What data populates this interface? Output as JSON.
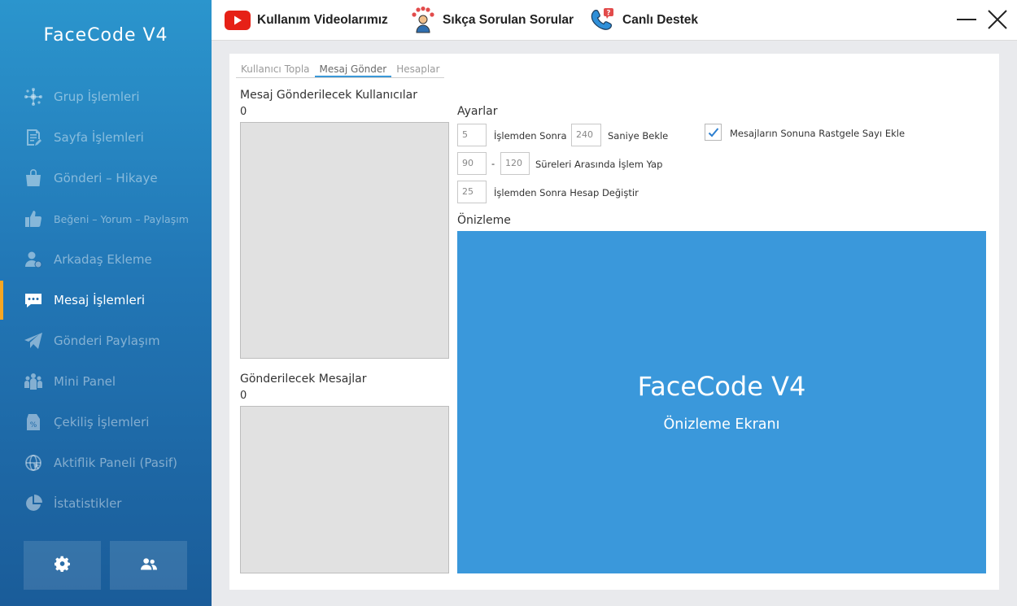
{
  "sidebar": {
    "app_title": "FaceCode V4",
    "items": [
      {
        "label": "Grup İşlemleri",
        "icon": "network-icon"
      },
      {
        "label": "Sayfa İşlemleri",
        "icon": "page-edit-icon"
      },
      {
        "label": "Gönderi – Hikaye",
        "icon": "shopping-bag-icon"
      },
      {
        "label": "Beğeni – Yorum – Paylaşım",
        "icon": "thumbs-up-icon"
      },
      {
        "label": "Arkadaş Ekleme",
        "icon": "user-add-icon"
      },
      {
        "label": "Mesaj İşlemleri",
        "icon": "chat-icon",
        "active": true
      },
      {
        "label": "Gönderi Paylaşım",
        "icon": "paper-plane-icon"
      },
      {
        "label": "Mini Panel",
        "icon": "group-icon"
      },
      {
        "label": "Çekiliş İşlemleri",
        "icon": "discount-tag-icon"
      },
      {
        "label": "Aktiflik Paneli (Pasif)",
        "icon": "globe-cursor-icon"
      },
      {
        "label": "İstatistikler",
        "icon": "pie-chart-icon"
      }
    ],
    "bottom_buttons": [
      "gear-icon",
      "users-icon"
    ]
  },
  "topbar": {
    "links": [
      {
        "label": "Kullanım Videolarımız",
        "icon": "youtube-icon"
      },
      {
        "label": "Sıkça Sorulan Sorular",
        "icon": "faq-person-icon"
      },
      {
        "label": "Canlı Destek",
        "icon": "phone-support-icon"
      }
    ]
  },
  "tabs": [
    "Kullanıcı Topla",
    "Mesaj Gönder",
    "Hesaplar"
  ],
  "users_section": {
    "title": "Mesaj Gönderilecek Kullanıcılar",
    "count": "0"
  },
  "messages_section": {
    "title": "Gönderilecek Mesajlar",
    "count": "0"
  },
  "settings": {
    "title": "Ayarlar",
    "after_ops_value": "5",
    "after_ops_label": "İşlemden Sonra",
    "wait_value": "240",
    "wait_label": "Saniye Bekle",
    "range_min": "90",
    "range_sep": "-",
    "range_max": "120",
    "range_label": "Süreleri Arasında İşlem Yap",
    "switch_value": "25",
    "switch_label": "İşlemden Sonra Hesap Değiştir",
    "random_number_label": "Mesajların Sonuna Rastgele Sayı Ekle",
    "random_number_checked": true
  },
  "preview": {
    "title": "Önizleme",
    "screen_title": "FaceCode V4",
    "screen_subtitle": "Önizleme Ekranı"
  },
  "colors": {
    "accent": "#3a98db",
    "active_marker": "#f5a623",
    "youtube_red": "#e62117"
  }
}
